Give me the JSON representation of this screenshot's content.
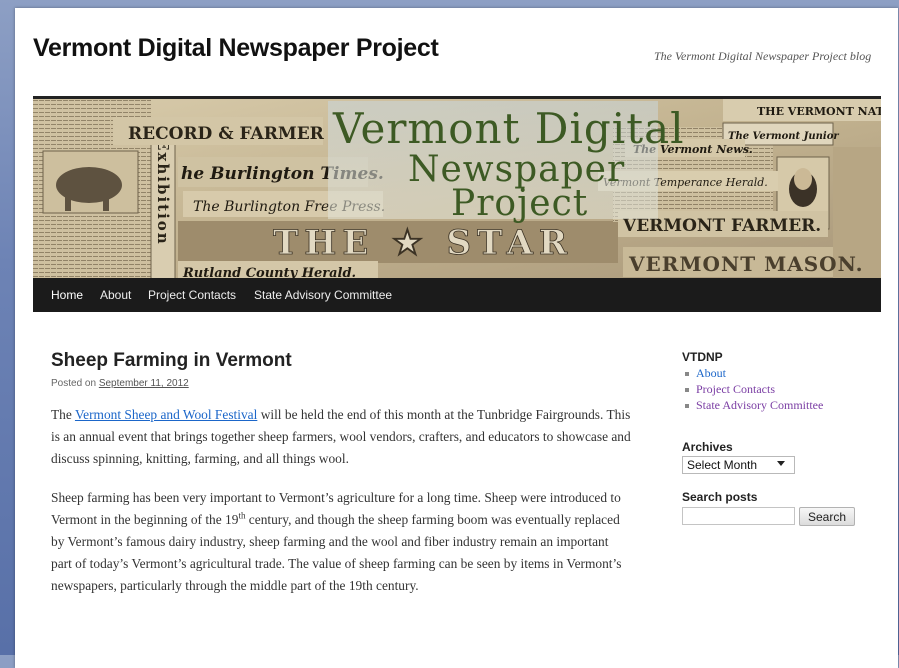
{
  "site": {
    "title": "Vermont Digital Newspaper Project",
    "description": "The Vermont Digital Newspaper Project blog"
  },
  "banner": {
    "line1": "Vermont Digital",
    "line2": "Newspaper",
    "line3": "Project",
    "mastheads": {
      "record_farmer": "RECORD & FARMER",
      "burlington_times": "he Burlington Times.",
      "burlington_free_press": "The Burlington Free Press.",
      "exhibition": "Exhibition",
      "vermont_national": "THE VERMONT NATIONAL",
      "vermont_junior": "The Vermont Junior",
      "vermont_news": "The Vermont News.",
      "temperance_herald": "Vermont Temperance Herald.",
      "vermont_farmer": "VERMONT FARMER.",
      "vermont_mason": "VERMONT MASON.",
      "star": "THE ★ STAR",
      "rutland_herald": "Rutland County Herald."
    },
    "colors": {
      "title": "#3d5a24",
      "paper": "#c6b898"
    }
  },
  "nav": {
    "items": [
      "Home",
      "About",
      "Project Contacts",
      "State Advisory Committee"
    ]
  },
  "post": {
    "title": "Sheep Farming in Vermont",
    "posted_on": "Posted on",
    "date": "September 11, 2012",
    "p1_before": "The ",
    "p1_link": "Vermont Sheep and Wool Festival",
    "p1_after": " will be held the end of this month at the Tunbridge Fairgrounds. This is an annual event that brings together sheep farmers, wool vendors, crafters, and educators to showcase and discuss spinning, knitting, farming, and all things wool.",
    "p2_before": "Sheep farming has been very important to Vermont’s agriculture for a long time. Sheep were introduced to Vermont in the beginning of the 19",
    "p2_sup": "th",
    "p2_after": " century, and though the sheep farming boom was eventually replaced by Vermont’s famous dairy industry, sheep farming and the wool and fiber industry remain an important part of today’s Vermont’s agricultural trade. The value of sheep farming can be seen by items in Vermont’s newspapers, particularly through the middle part of the 19th century."
  },
  "sidebar": {
    "vtdnp_title": "VTDNP",
    "links": [
      "About",
      "Project Contacts",
      "State Advisory Committee"
    ],
    "archives_title": "Archives",
    "archives_select": "Select Month",
    "search_title": "Search posts",
    "search_placeholder": "",
    "search_button": "Search"
  },
  "colors": {
    "link": "#1b66c9",
    "visited": "#7a3da3",
    "nav_bg": "#1b1b1b",
    "background": "#6d83b5"
  }
}
